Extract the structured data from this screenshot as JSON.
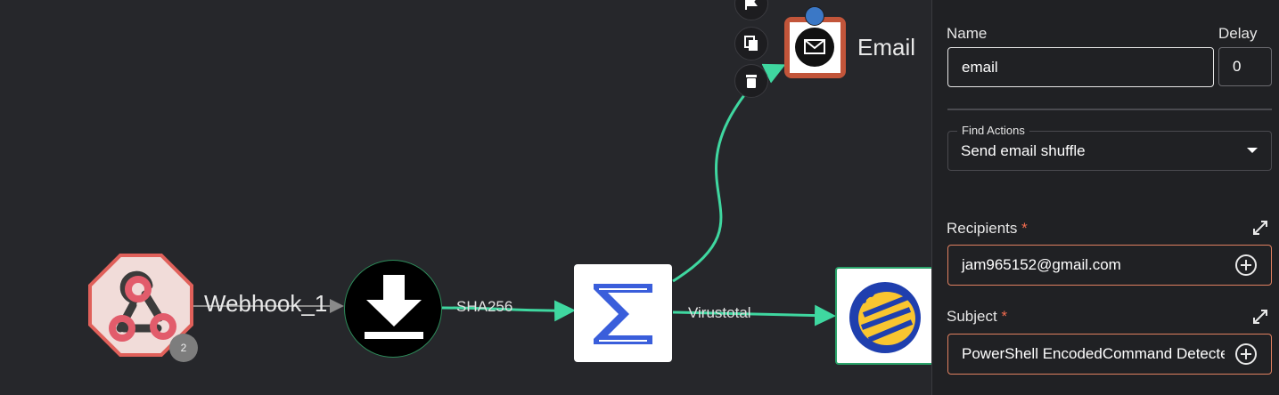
{
  "canvas": {
    "nodes": {
      "webhook": {
        "label": "Webhook_1",
        "badge": "2"
      },
      "download": {
        "label": "SHA256"
      },
      "shuffle_tools": {
        "label": "Virustotal"
      },
      "email": {
        "label": "Email"
      }
    },
    "toolbar": {
      "icons": [
        "flag-icon",
        "copy-icon",
        "delete-icon"
      ]
    },
    "colors": {
      "edge": "#3fd7a0",
      "selected_border": "#c2553a",
      "background": "#26272b"
    }
  },
  "panel": {
    "name_label": "Name",
    "name_value": "email",
    "delay_label": "Delay",
    "delay_value": "0",
    "find_actions_label": "Find Actions",
    "find_actions_value": "Send email shuffle",
    "recipients_label": "Recipients",
    "recipients_required": "*",
    "recipients_value": "jam965152@gmail.com",
    "subject_label": "Subject",
    "subject_required": "*",
    "subject_value": "PowerShell EncodedCommand Detected"
  }
}
